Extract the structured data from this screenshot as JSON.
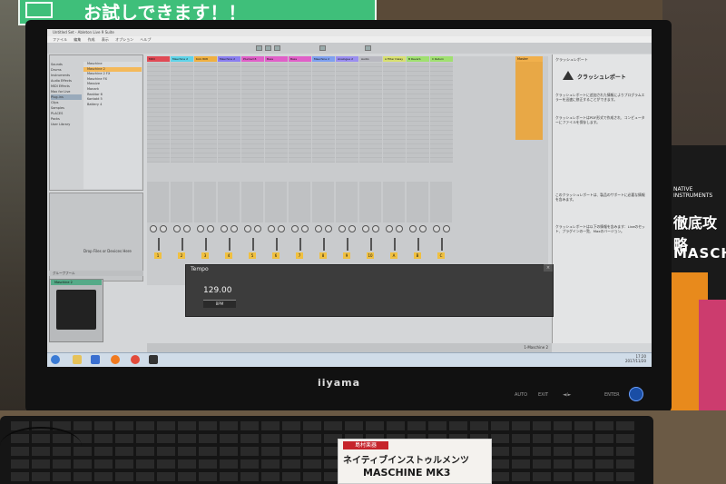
{
  "store_sign": {
    "text": "お試しできます！！"
  },
  "monitor": {
    "brand": "iiyama",
    "buttons": [
      "AUTO",
      "EXIT",
      "◄/►",
      "ENTER"
    ]
  },
  "app": {
    "title": "Untitled Set - Ableton Live 9 Suite",
    "menu": [
      "ファイル",
      "編集",
      "作成",
      "表示",
      "オプション",
      "ヘルプ"
    ]
  },
  "browser": {
    "categories": [
      "Sounds",
      "Drums",
      "Instruments",
      "Audio Effects",
      "MIDI Effects",
      "Max for Live",
      "Plug-ins",
      "Clips",
      "Samples",
      "PLACES",
      "Packs",
      "User Library"
    ],
    "selected_category": "Plug-ins",
    "items": [
      "Maschine",
      "Maschine 2",
      "Maschine 2 FX",
      "Maschine FX",
      "Massive",
      "Monark",
      "Reaktor 6",
      "Kontakt 5",
      "Battery 4"
    ],
    "selected_item": "Maschine 2"
  },
  "drop_area": {
    "label": "Drop Files or Devices Here"
  },
  "groove_pool": {
    "label": "グルーヴプール"
  },
  "device": {
    "name": "Maschine 2"
  },
  "tracks": [
    {
      "name": "MIDI",
      "color": "#e04a55"
    },
    {
      "name": "Maschine 2",
      "color": "#5fd3e8"
    },
    {
      "name": "Kick 808",
      "color": "#f0b040"
    },
    {
      "name": "Maschine 2",
      "color": "#8a7ef0"
    },
    {
      "name": "Plucked 8",
      "color": "#e060c8"
    },
    {
      "name": "Bass",
      "color": "#e060c8"
    },
    {
      "name": "Bass",
      "color": "#e060c8"
    },
    {
      "name": "Maschine 2",
      "color": "#7fa0f0"
    },
    {
      "name": "Analogue 2",
      "color": "#9a8ef0"
    },
    {
      "name": "Audio",
      "color": "#b8b8c0"
    },
    {
      "name": "A Filter Delay",
      "color": "#d8e070"
    },
    {
      "name": "B Reverb",
      "color": "#a0e070"
    },
    {
      "name": "C Return",
      "color": "#a0e070"
    },
    {
      "name": "Master",
      "color": "#f1b04c"
    }
  ],
  "track_numbers": [
    "1",
    "2",
    "3",
    "4",
    "5",
    "6",
    "7",
    "8",
    "9",
    "10",
    "A",
    "B",
    "C"
  ],
  "crash_report": {
    "panel_title": "クラッシュレポート",
    "heading": "クラッシュレポート",
    "paragraphs": [
      "クラッシュレポートに追加された情報によりプログラムエラーを迅速に修正することができます。",
      "クラッシュレポートはPDF形式で作成され、コンピューターにファイルを保存します。",
      "このクラッシュレポートは、製品のサポートに必要な情報を含みます。",
      "クラッシュレポートは以下の情報を含みます：Liveのセット、プラグインの一覧、Maxのバージョン。"
    ]
  },
  "tempo_popup": {
    "title": "Tempo",
    "value": "129.00",
    "unit": "BPM"
  },
  "status_bar": {
    "text": "1-Maschine 2"
  },
  "taskbar": {
    "time": "17:20",
    "date": "2017/11/20"
  },
  "price_tag": {
    "shop": "島村楽器",
    "line1": "ネイティブインストゥルメンツ",
    "line2": "MASCHINE MK3"
  },
  "product_box": {
    "brand": "NATIVE INSTRUMENTS",
    "title": "徹底攻略",
    "name": "MASCH"
  }
}
